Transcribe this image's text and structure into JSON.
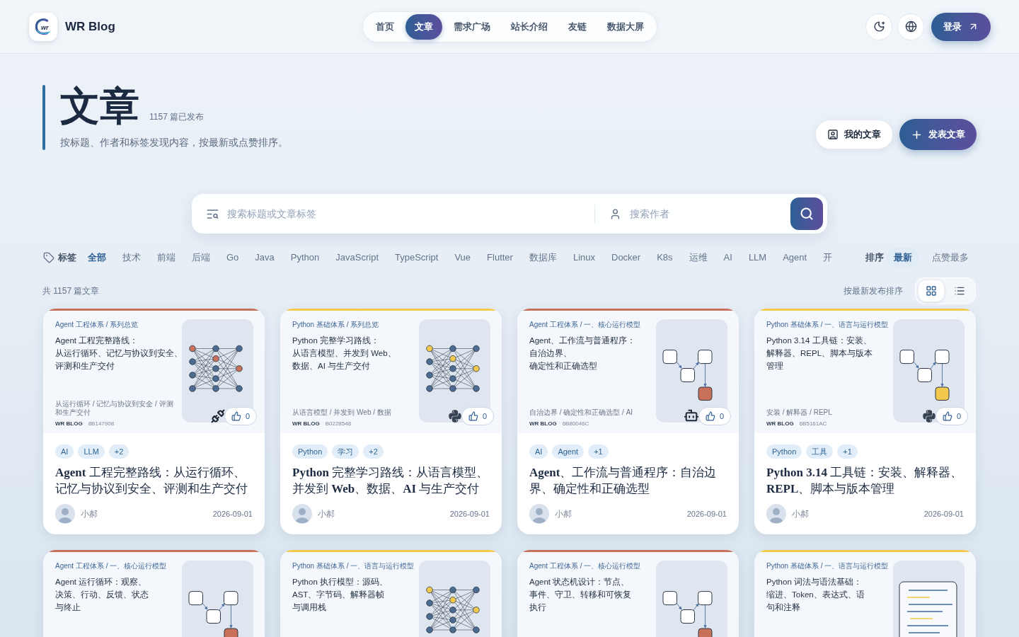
{
  "header": {
    "logo_mark": "wr",
    "brand": "WR Blog",
    "nav": [
      {
        "label": "首页",
        "selected": false
      },
      {
        "label": "文章",
        "selected": true
      },
      {
        "label": "需求广场",
        "selected": false
      },
      {
        "label": "站长介绍",
        "selected": false
      },
      {
        "label": "友链",
        "selected": false
      },
      {
        "label": "数据大屏",
        "selected": false
      }
    ],
    "login": "登录"
  },
  "hero": {
    "title": "文章",
    "count": "1157 篇已发布",
    "subtitle": "按标题、作者和标签发现内容，按最新或点赞排序。",
    "actions": [
      {
        "kind": "secondary",
        "label": "我的文章"
      },
      {
        "kind": "primary",
        "label": "发表文章"
      }
    ]
  },
  "search": {
    "query_placeholder": "搜索标题或文章标签",
    "author_placeholder": "搜索作者"
  },
  "tags": {
    "label": "标签",
    "items": [
      {
        "label": "全部",
        "selected": true
      },
      {
        "label": "技术",
        "selected": false
      },
      {
        "label": "前端",
        "selected": false
      },
      {
        "label": "后端",
        "selected": false
      },
      {
        "label": "Go",
        "selected": false
      },
      {
        "label": "Java",
        "selected": false
      },
      {
        "label": "Python",
        "selected": false
      },
      {
        "label": "JavaScript",
        "selected": false
      },
      {
        "label": "TypeScript",
        "selected": false
      },
      {
        "label": "Vue",
        "selected": false
      },
      {
        "label": "Flutter",
        "selected": false
      },
      {
        "label": "数据库",
        "selected": false
      },
      {
        "label": "Linux",
        "selected": false
      },
      {
        "label": "Docker",
        "selected": false
      },
      {
        "label": "K8s",
        "selected": false
      },
      {
        "label": "运维",
        "selected": false
      },
      {
        "label": "AI",
        "selected": false
      },
      {
        "label": "LLM",
        "selected": false
      },
      {
        "label": "Agent",
        "selected": false
      },
      {
        "label": "开",
        "selected": false
      }
    ]
  },
  "sort": {
    "label": "排序",
    "options": [
      {
        "label": "最新",
        "selected": true
      },
      {
        "label": "点赞最多",
        "selected": false
      }
    ]
  },
  "summary": {
    "total": "共 1157 篇文章",
    "order": "按最新发布排序",
    "views": [
      {
        "kind": "grid",
        "selected": true
      },
      {
        "kind": "list",
        "selected": false
      }
    ]
  },
  "cards": [
    {
      "color": "#c8705a",
      "meta": "Agent 工程体系 / 系列总览",
      "cover_lines": [
        "Agent 工程完整路线：",
        "从运行循环、记忆与协议到安全、",
        "评测和生产交付"
      ],
      "art": {
        "kind": "network"
      },
      "breadcrumb": "从运行循环 / 记忆与协议到安全 / 评测和生产交付",
      "brand": "WR BLOG",
      "code": "8B147908",
      "emblem": {
        "kind": "plug"
      },
      "likes": "0",
      "tags": [
        "AI",
        "LLM",
        "+2"
      ],
      "title": "**Agent** 工程完整路线：从运行循环、记忆与协议到安全、评测和生产交付",
      "author": "小郝",
      "date": "2026-09-01"
    },
    {
      "color": "#f2c94c",
      "meta": "Python 基础体系 / 系列总览",
      "cover_lines": [
        "Python 完整学习路线：",
        "从语言模型、并发到 Web、",
        "数据、AI 与生产交付"
      ],
      "art": {
        "kind": "network"
      },
      "breadcrumb": "从语言模型 / 并发到 Web / 数据",
      "brand": "WR BLOG",
      "code": "B0228548",
      "emblem": {
        "kind": "python"
      },
      "likes": "0",
      "tags": [
        "Python",
        "学习",
        "+2"
      ],
      "title": "**Python** 完整学习路线：从语言模型、并发到 **Web**、数据、**AI** 与生产交付",
      "author": "小郝",
      "date": "2026-09-01"
    },
    {
      "color": "#c8705a",
      "meta": "Agent 工程体系 / 一、核心运行模型",
      "cover_lines": [
        "Agent、工作流与普通程序：",
        "自治边界、",
        "确定性和正确选型"
      ],
      "art": {
        "kind": "flow"
      },
      "breadcrumb": "自治边界 / 确定性和正确选型 / AI",
      "brand": "WR BLOG",
      "code": "6B80046C",
      "emblem": {
        "kind": "robot"
      },
      "likes": "0",
      "tags": [
        "AI",
        "Agent",
        "+1"
      ],
      "title": "**Agent**、工作流与普通程序：自治边界、确定性和正确选型",
      "author": "小郝",
      "date": "2026-09-01"
    },
    {
      "color": "#f2c94c",
      "meta": "Python 基础体系 / 一、语言与运行模型",
      "cover_lines": [
        "Python 3.14 工具链：安装、",
        "解释器、REPL、脚本与版本",
        "管理"
      ],
      "art": {
        "kind": "flow"
      },
      "breadcrumb": "安装 / 解释器 / REPL",
      "brand": "WR BLOG",
      "code": "6B5161AC",
      "emblem": {
        "kind": "python"
      },
      "likes": "0",
      "tags": [
        "Python",
        "工具",
        "+1"
      ],
      "title": "**Python 3.14** 工具链：安装、解释器、**REPL**、脚本与版本管理",
      "author": "小郝",
      "date": "2026-09-01"
    },
    {
      "color": "#c8705a",
      "meta": "Agent 工程体系 / 一、核心运行模型",
      "cover_lines": [
        "Agent 运行循环：观察、",
        "决策、行动、反馈、状态",
        "与终止"
      ],
      "art": {
        "kind": "flow"
      }
    },
    {
      "color": "#f2c94c",
      "meta": "Python 基础体系 / 一、语言与运行模型",
      "cover_lines": [
        "Python 执行模型：源码、",
        "AST、字节码、解释器帧",
        "与调用栈"
      ],
      "art": {
        "kind": "network"
      }
    },
    {
      "color": "#c8705a",
      "meta": "Agent 工程体系 / 一、核心运行模型",
      "cover_lines": [
        "Agent 状态机设计：节点、",
        "事件、守卫、转移和可恢复",
        "执行"
      ],
      "art": {
        "kind": "flow"
      }
    },
    {
      "color": "#f2c94c",
      "meta": "Python 基础体系 / 一、语言与运行模型",
      "cover_lines": [
        "Python 词法与语法基础：",
        "缩进、Token、表达式、语",
        "句和注释"
      ],
      "art": {
        "kind": "document"
      }
    }
  ]
}
